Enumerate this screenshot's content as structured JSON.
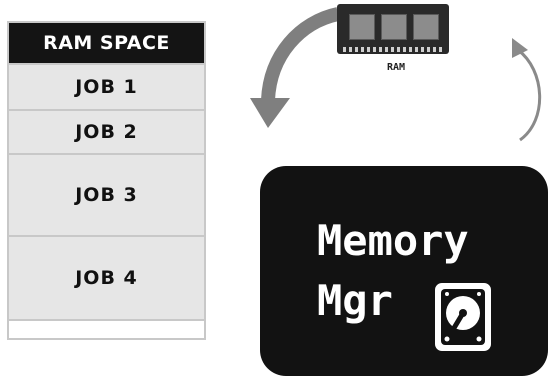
{
  "ram_table": {
    "header": "RAM SPACE",
    "jobs": [
      "JOB 1",
      "JOB 2",
      "JOB 3",
      "JOB 4"
    ]
  },
  "ram_chip": {
    "label": "RAM"
  },
  "memory_manager": {
    "line1": "Memory",
    "line2": "Mgr",
    "icon": "hard-disk-icon"
  },
  "colors": {
    "header_bg": "#141414",
    "row_bg": "#e6e6e6",
    "arrow": "#7f7f7f",
    "box_bg": "#121212"
  }
}
